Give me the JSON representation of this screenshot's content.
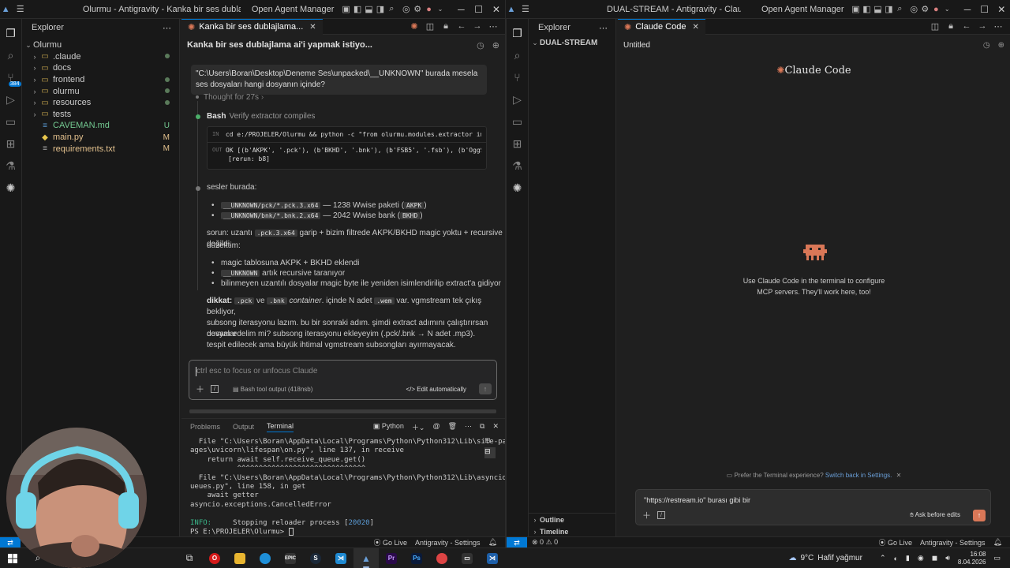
{
  "left_window": {
    "title": "Olurmu - Antigravity - Kanka bir ses dublajlama...",
    "agent_manager": "Open Agent Manager",
    "explorer_title": "Explorer",
    "root_folder": "Olurmu",
    "tree": [
      {
        "name": ".claude",
        "type": "folder",
        "status": "dot"
      },
      {
        "name": "docs",
        "type": "folder",
        "status": ""
      },
      {
        "name": "frontend",
        "type": "folder",
        "status": "dot"
      },
      {
        "name": "olurmu",
        "type": "folder",
        "status": "dot"
      },
      {
        "name": "resources",
        "type": "folder",
        "status": "dot"
      },
      {
        "name": "tests",
        "type": "folder",
        "status": ""
      },
      {
        "name": "CAVEMAN.md",
        "type": "md",
        "status": "U"
      },
      {
        "name": "main.py",
        "type": "py",
        "status": "M"
      },
      {
        "name": "requirements.txt",
        "type": "txt",
        "status": "M"
      }
    ],
    "tab_label": "Kanka bir ses dublajlama...",
    "chat": {
      "header": "Kanka bir ses dublajlama ai'i yapmak istiyo...",
      "user_msg": "\"C:\\Users\\Boran\\Desktop\\Deneme Ses\\unpacked\\__UNKNOWN\" burada mesela ses dosyaları hangi dosyanın içinde?",
      "thought": "Thought for 27s",
      "bash_label": "Bash",
      "bash_desc": "Verify extractor compiles",
      "in_label": "IN",
      "in_cmd": "cd e:/PROJELER/Olurmu && python -c \"from olurmu.modules.extractor import Extract",
      "out_label": "OUT",
      "out_line1": "OK [(b'AKPK', '.pck'), (b'BKHD', '.bnk'), (b'FSB5', '.fsb'), (b'OggS', '.ogg'),",
      "out_line2": "[rerun: b8]",
      "sesler": "sesler burada:",
      "b1_code": "__UNKNOWN/pck/*.pck.3.x64",
      "b1_text": " — 1238 Wwise paketi (",
      "b1_tag": "AKPK",
      "b2_code": "__UNKNOWN/bnk/*.bnk.2.x64",
      "b2_text": " — 2042 Wwise bank (",
      "b2_tag": "BKHD",
      "sorun_pre": "sorun: uzantı ",
      "sorun_code": ".pck.3.x64",
      "sorun_post": " garip + bizim filtrede AKPK/BKHD magic yoktu + recursive değildi.",
      "duzelttim": "düzelttim:",
      "fix1": "magic tablosuna AKPK + BKHD eklendi",
      "fix2_code": "__UNKNOWN",
      "fix2_text": " artık recursive taranıyor",
      "fix3": "bilinmeyen uzantılı dosyalar magic byte ile yeniden isimlendirilip extract'a gidiyor",
      "dikkat_label": "dikkat:",
      "dk_pck": ".pck",
      "dk_ve": " ve ",
      "dk_bnk": ".bnk",
      "dk_cont": " container",
      "dk_mid": ". içinde N adet ",
      "dk_wem": ".wem",
      "dk_rest1": " var. vgmstream tek çıkış bekliyor,",
      "dk_line2": "subsong iterasyonu lazım. bu bir sonraki adım. şimdi extract adımını çalıştırırsan dosyalar",
      "dk_line3": "tespit edilecek ama büyük ihtimal vgmstream subsongları ayırmayacak.",
      "devam": "devam edelim mi? subsong iterasyonu ekleyeyim (.pck/.bnk → N adet .mp3).",
      "input_placeholder": "ctrl esc to focus or unfocus Claude",
      "attach_label": "Bash tool output (418nsb)",
      "edit_mode": "Edit automatically"
    },
    "panel": {
      "tabs": [
        "Problems",
        "Output",
        "Terminal"
      ],
      "active_tab": "Terminal",
      "shell": "Python",
      "lines": [
        "  File \"C:\\Users\\Boran\\AppData\\Local\\Programs\\Python\\Python312\\Lib\\site-pack",
        "ages\\uvicorn\\lifespan\\on.py\", line 137, in receive",
        "    return await self.receive_queue.get()",
        "           ^^^^^^^^^^^^^^^^^^^^^^^^^^^^^^",
        "  File \"C:\\Users\\Boran\\AppData\\Local\\Programs\\Python\\Python312\\Lib\\asyncio\\q",
        "ueues.py\", line 158, in get",
        "    await getter",
        "asyncio.exceptions.CancelledError",
        ""
      ],
      "info_label": "INFO:",
      "info_text": "     Stopping reloader process [",
      "info_pid": "20020",
      "info_end": "]",
      "prompt": "PS E:\\PROJELER\\Olurmu> "
    },
    "status": {
      "go_live": "Go Live",
      "settings": "Antigravity - Settings"
    }
  },
  "right_window": {
    "title": "DUAL-STREAM - Antigravity - Claude Code",
    "agent_manager": "Open Agent Manager",
    "explorer_title": "Explorer",
    "root_folder": "DUAL-STREAM",
    "tab_label": "Claude Code",
    "untitled": "Untitled",
    "logo_text": "Claude Code",
    "mcp_line1": "Use Claude Code in the terminal to configure",
    "mcp_line2": "MCP servers. They'll work here, too!",
    "prefer_text": "Prefer the Terminal experience?",
    "prefer_link": "Switch back in Settings.",
    "input_value": "\"https://restream.io\" burası gibi bir",
    "mode_label": "Ask before edits",
    "outline": "Outline",
    "timeline": "Timeline",
    "status": {
      "errors": "0",
      "warnings": "0",
      "go_live": "Go Live",
      "settings": "Antigravity - Settings"
    }
  },
  "taskbar": {
    "weather_temp": "9°C",
    "weather_text": "Hafif yağmur",
    "time": "16:08",
    "date": "8.04.2026"
  },
  "colors": {
    "accent": "#0078d4",
    "claude_orange": "#d97757",
    "modified": "#e2c08d",
    "untracked": "#73c991"
  }
}
